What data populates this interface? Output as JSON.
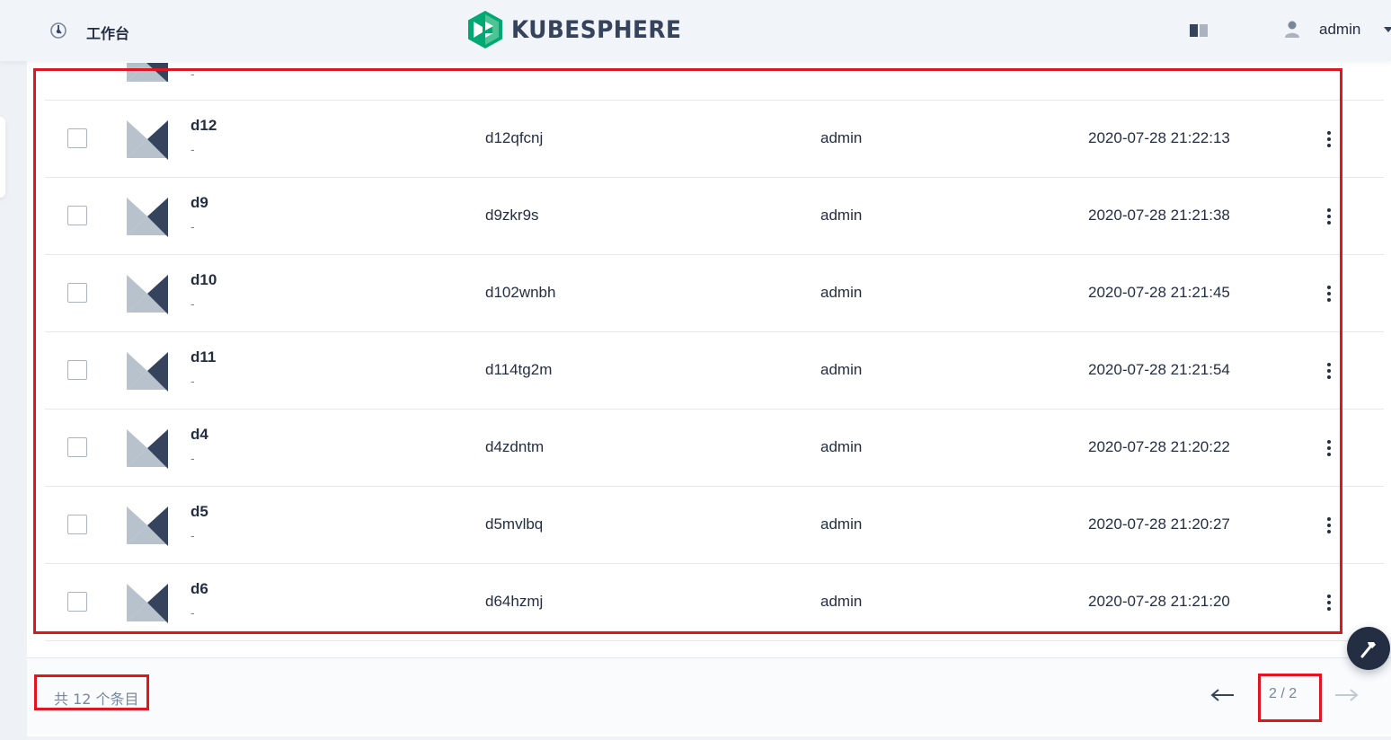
{
  "header": {
    "workbench_label": "工作台",
    "logo_text": "KUBESPHERE",
    "user_name": "admin"
  },
  "table": {
    "rows": [
      {
        "name": "d12",
        "description": "-",
        "id": "d12qfcnj",
        "creator": "admin",
        "created": "2020-07-28 21:22:13"
      },
      {
        "name": "d9",
        "description": "-",
        "id": "d9zkr9s",
        "creator": "admin",
        "created": "2020-07-28 21:21:38"
      },
      {
        "name": "d10",
        "description": "-",
        "id": "d102wnbh",
        "creator": "admin",
        "created": "2020-07-28 21:21:45"
      },
      {
        "name": "d11",
        "description": "-",
        "id": "d114tg2m",
        "creator": "admin",
        "created": "2020-07-28 21:21:54"
      },
      {
        "name": "d4",
        "description": "-",
        "id": "d4zdntm",
        "creator": "admin",
        "created": "2020-07-28 21:20:22"
      },
      {
        "name": "d5",
        "description": "-",
        "id": "d5mvlbq",
        "creator": "admin",
        "created": "2020-07-28 21:20:27"
      },
      {
        "name": "d6",
        "description": "-",
        "id": "d64hzmj",
        "creator": "admin",
        "created": "2020-07-28 21:21:20"
      }
    ],
    "partial_row_description": "-"
  },
  "footer": {
    "total_label": "共 12 个条目",
    "page_indicator": "2 / 2"
  },
  "colors": {
    "brand_green": "#00a971",
    "annotation_red": "#e0161e",
    "text_primary": "#242e42",
    "text_secondary": "#79879c"
  },
  "icons": {
    "workbench": "dashboard-icon",
    "docs": "book-icon",
    "user": "user-icon",
    "row": "project-icon",
    "more": "more-vertical-icon",
    "prev": "arrow-left-icon",
    "next": "arrow-right-icon",
    "tool": "hammer-icon"
  }
}
